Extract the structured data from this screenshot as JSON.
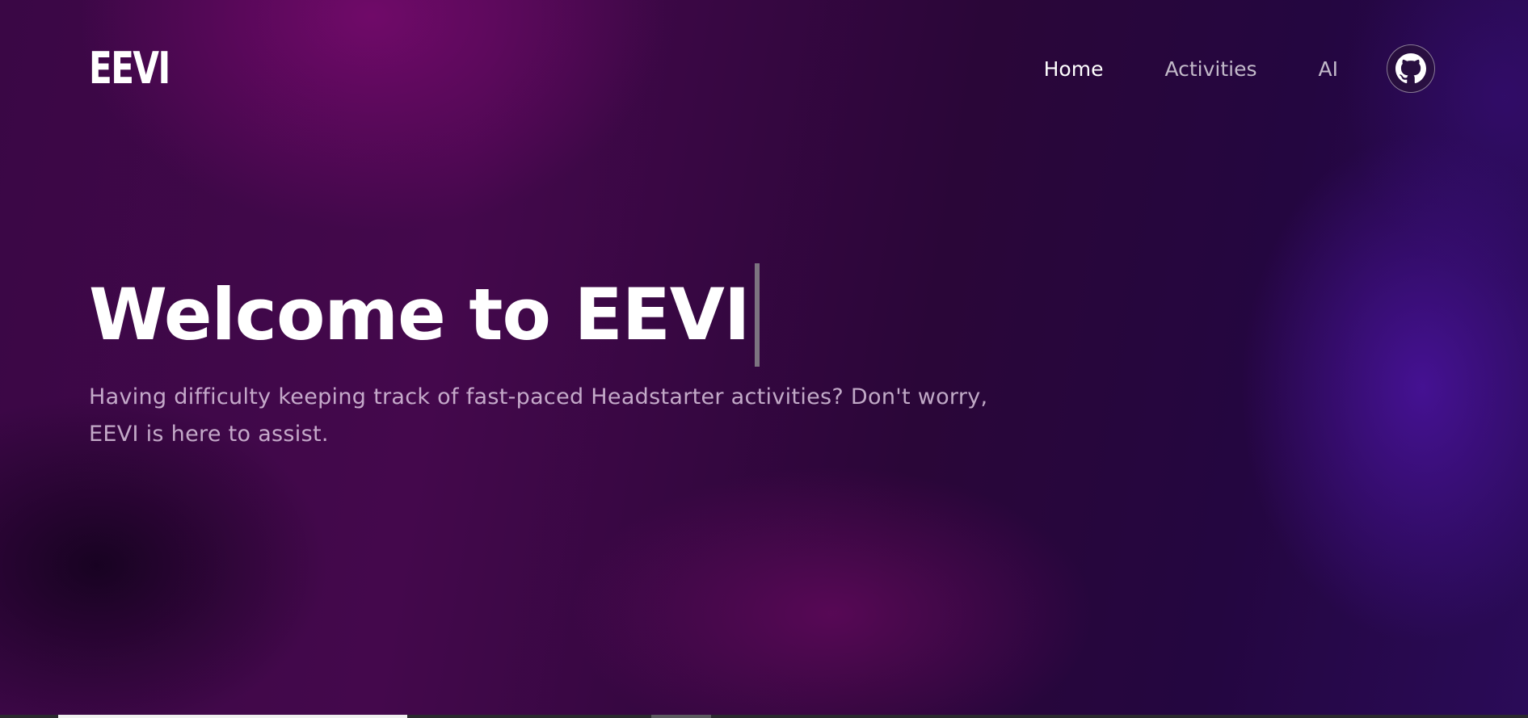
{
  "brand": {
    "logo_text": "EEVI"
  },
  "nav": {
    "items": [
      {
        "label": "Home",
        "active": true
      },
      {
        "label": "Activities",
        "active": false
      },
      {
        "label": "AI",
        "active": false
      }
    ],
    "github_icon": "github-icon"
  },
  "hero": {
    "title": "Welcome to EEVI",
    "subtitle": "Having difficulty keeping track of fast-paced Headstarter activities? Don't worry, EEVI is here to assist."
  },
  "colors": {
    "background_primary": "#3a0745",
    "background_accent": "#2a0b58",
    "text_primary": "#ffffff",
    "text_muted": "#d7bfdc"
  }
}
